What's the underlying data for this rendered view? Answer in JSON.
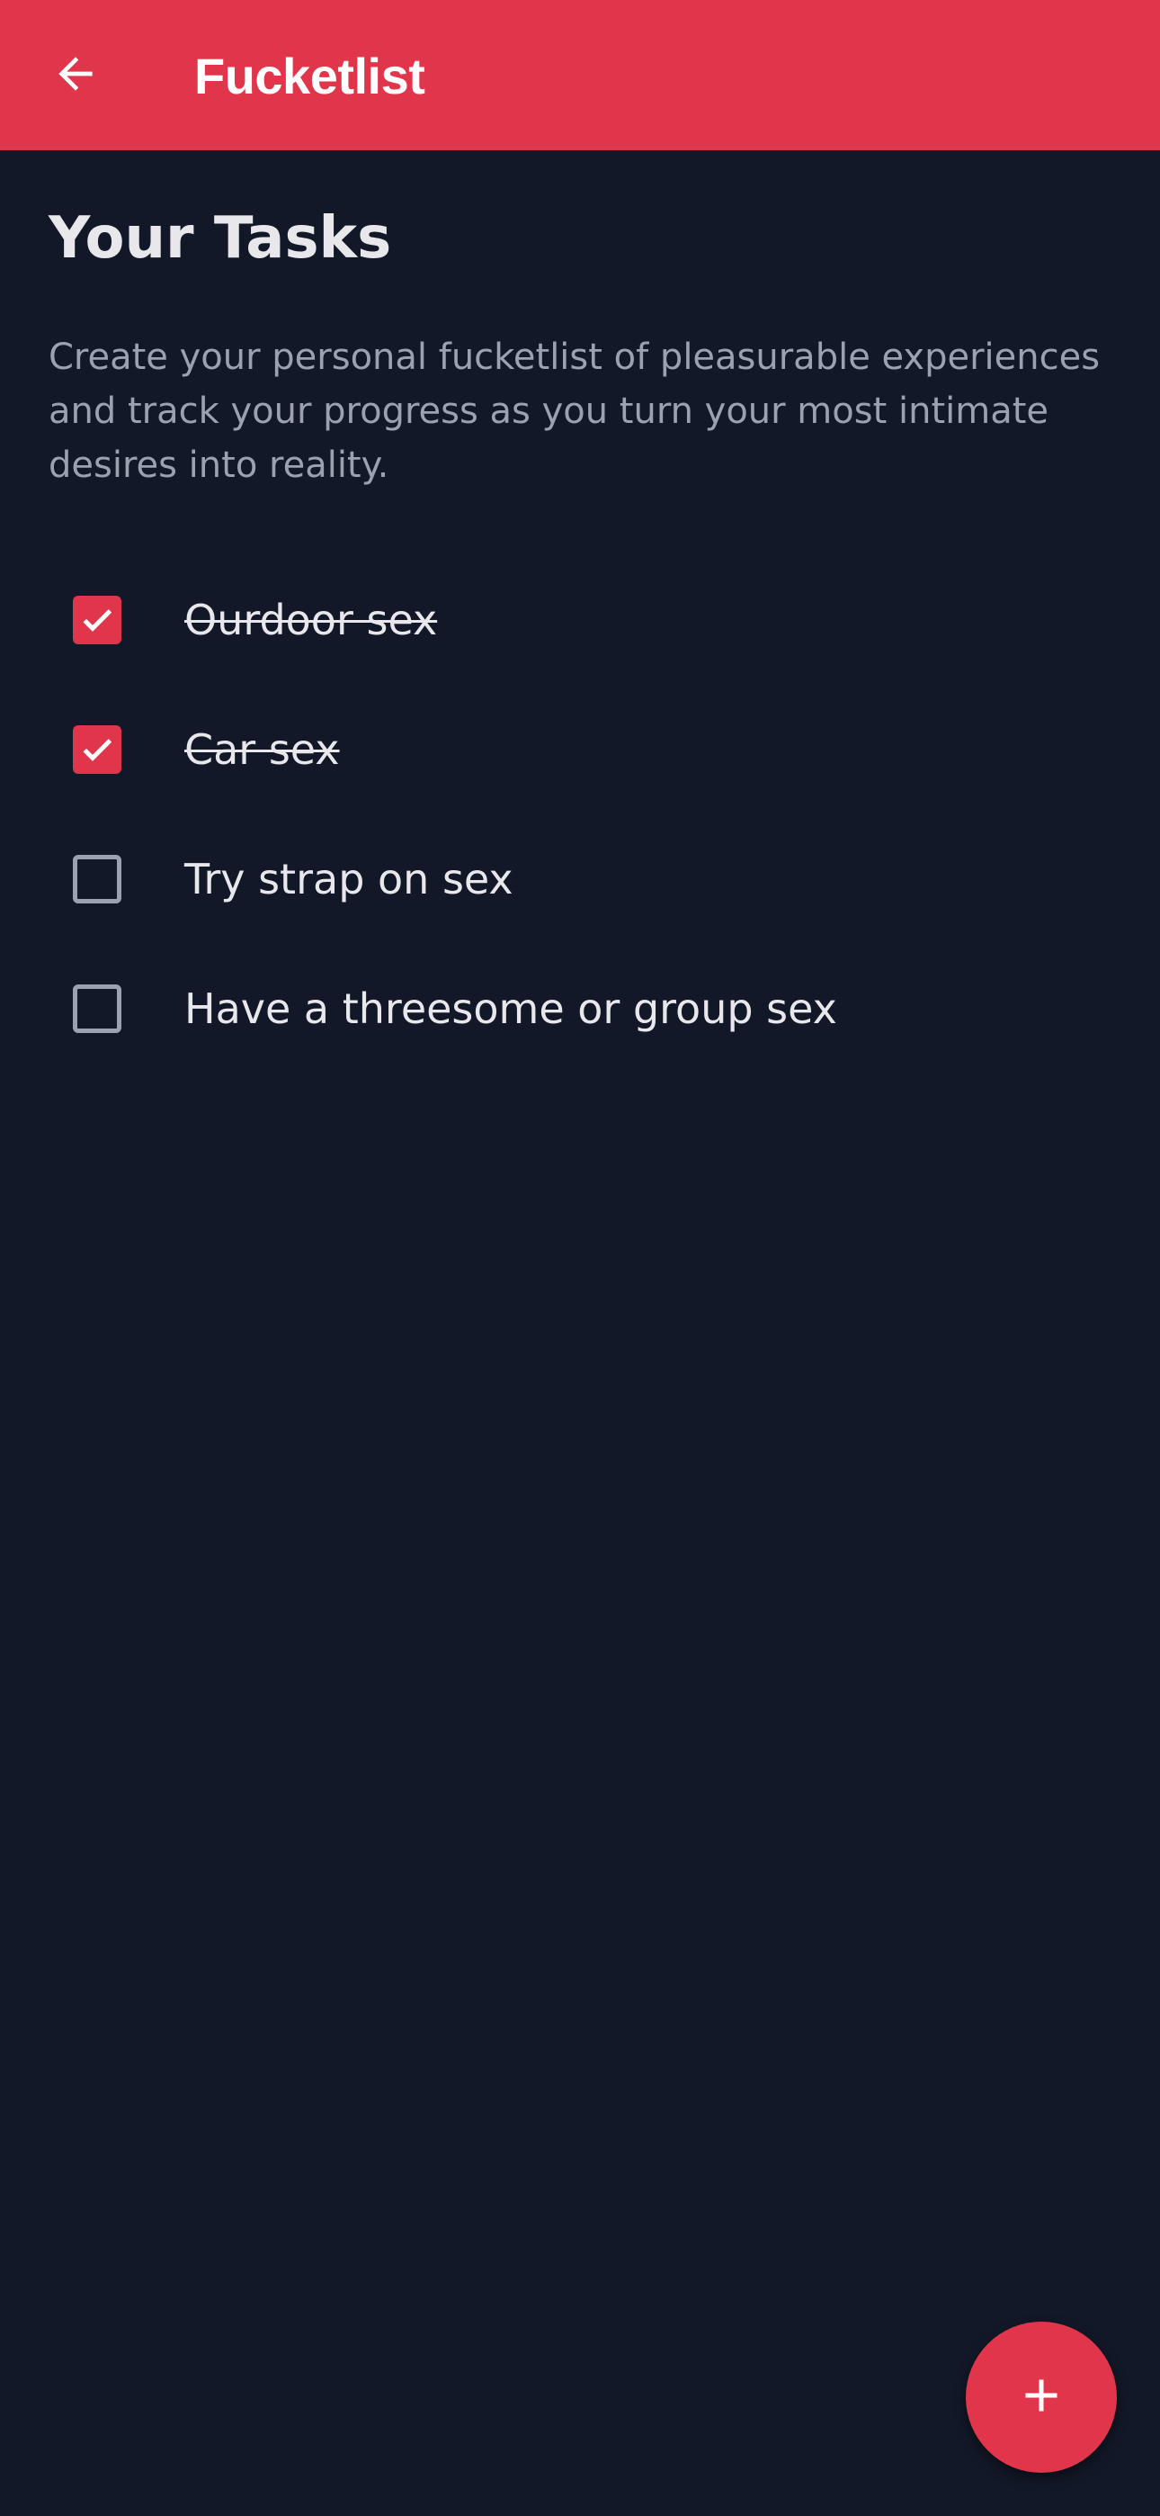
{
  "appbar": {
    "title": "Fucketlist",
    "back_icon": "arrow-left-icon",
    "color": "#E0354A"
  },
  "main": {
    "title": "Your Tasks",
    "description": "Create your personal fucketlist of pleasurable experiences and track your progress as you turn your most intimate desires into reality."
  },
  "tasks": [
    {
      "label": "Ourdoor sex",
      "checked": true
    },
    {
      "label": "Car sex",
      "checked": true
    },
    {
      "label": "Try strap on sex",
      "checked": false
    },
    {
      "label": "Have a threesome or group sex",
      "checked": false
    }
  ],
  "fab": {
    "icon": "plus-icon"
  },
  "colors": {
    "background": "#121827",
    "accent": "#E0354A",
    "text": "#E8E8EC",
    "muted": "#9CA1B0"
  }
}
